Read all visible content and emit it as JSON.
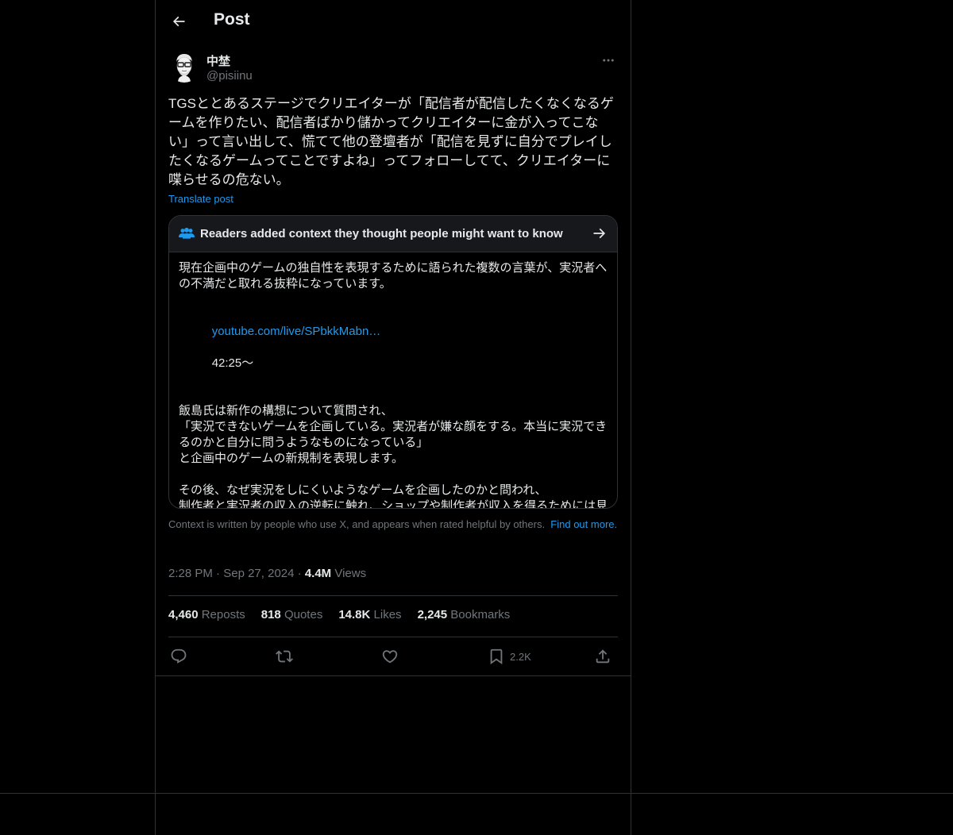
{
  "header": {
    "title": "Post"
  },
  "author": {
    "display_name": "中埜",
    "handle": "@pisiinu"
  },
  "tweet": {
    "text": "TGSととあるステージでクリエイターが「配信者が配信したくなくなるゲームを作りたい、配信者ばかり儲かってクリエイターに金が入ってこない」って言い出して、慌てて他の登壇者が「配信を見ずに自分でプレイしたくなるゲームってことですよね」ってフォローしてて、クリエイターに喋らせるの危ない。",
    "translate_label": "Translate post"
  },
  "context": {
    "heading": "Readers added context they thought people might want to know",
    "para1": "現在企画中のゲームの独自性を表現するために語られた複数の言葉が、実況者への不満だと取れる抜粋になっています。",
    "link": "youtube.com/live/SPbkkMabn…",
    "timestamp": "42:25〜",
    "para3": "飯島氏は新作の構想について質問され、\n「実況できないゲームを企画している。実況者が嫌な顔をする。本当に実況できるのかと自分に問うようなものになっている」\nと企画中のゲームの新規制を表現します。",
    "para4": "その後、なぜ実況をしにくいようなゲームを企画したのかと問われ、\n制作者と実況者の収入の逆転に触れ、ショップや制作者が収入を得るためには見るだけではなく自分で遊ばないといけないと思うものにする必要があるからだと回答しました。",
    "footnote": "Context is written by people who use X, and appears when rated helpful by others.",
    "footnote_link": "Find out more."
  },
  "meta": {
    "time": "2:28 PM",
    "date": "Sep 27, 2024",
    "views_count": "4.4M",
    "views_label": "Views",
    "separator": "·"
  },
  "stats": {
    "reposts_count": "4,460",
    "reposts_label": "Reposts",
    "quotes_count": "818",
    "quotes_label": "Quotes",
    "likes_count": "14.8K",
    "likes_label": "Likes",
    "bookmarks_count": "2,245",
    "bookmarks_label": "Bookmarks"
  },
  "actions": {
    "bookmark_count": "2.2K"
  },
  "colors": {
    "background": "#000000",
    "text": "#e7e9ea",
    "secondary": "#71767b",
    "accent": "#1d9bf0",
    "border": "#2f3336"
  },
  "icons": {
    "back": "arrow-left-icon",
    "more": "more-dots-icon",
    "people": "people-icon",
    "arrow": "arrow-right-icon",
    "reply": "reply-icon",
    "repost": "repost-icon",
    "like": "heart-icon",
    "bookmark": "bookmark-icon",
    "share": "share-icon"
  }
}
